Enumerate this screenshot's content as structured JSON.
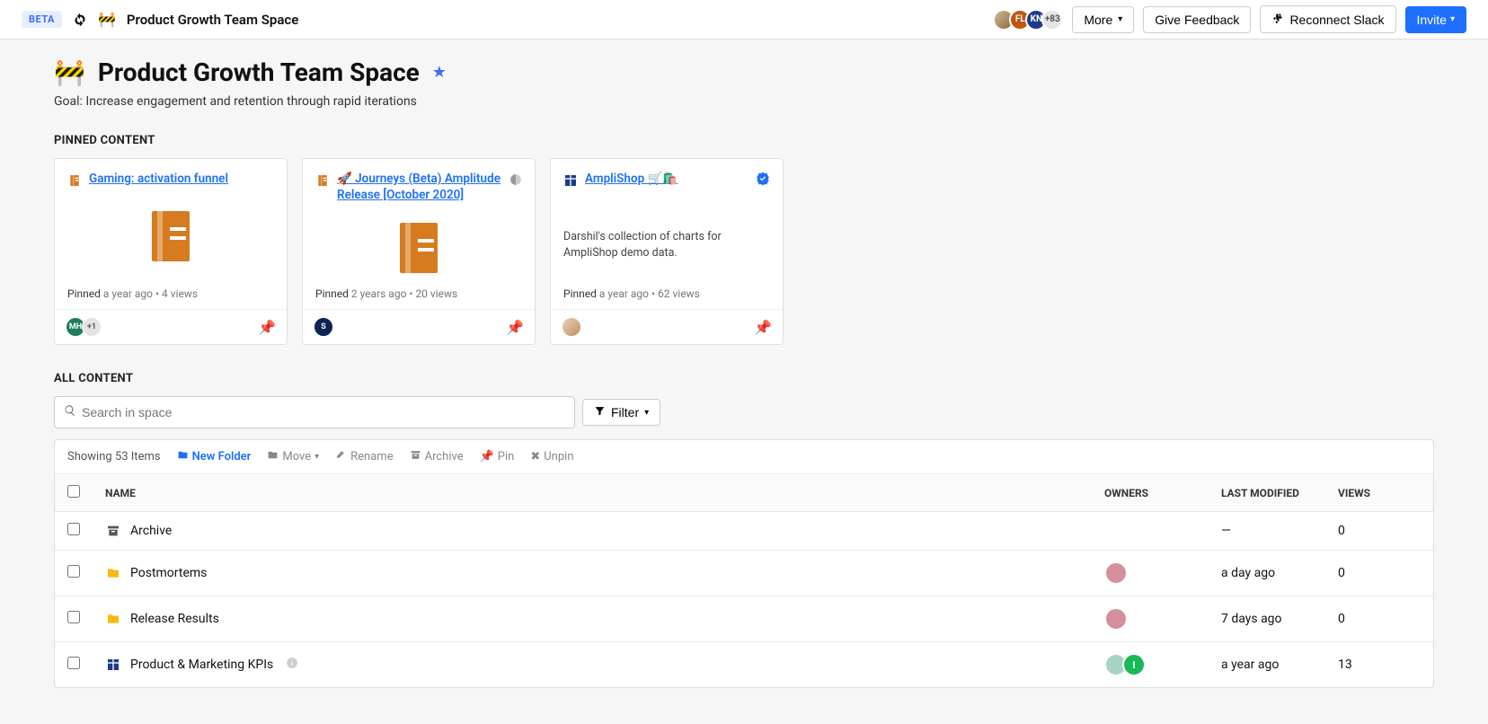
{
  "topbar": {
    "beta": "BETA",
    "emoji": "🚧",
    "crumb": "Product Growth Team Space",
    "avatars": {
      "fl": "FL",
      "kn": "KN",
      "count": "+83"
    },
    "more": "More",
    "feedback": "Give Feedback",
    "reconnect": "Reconnect Slack",
    "invite": "Invite"
  },
  "header": {
    "emoji": "🚧",
    "title": "Product Growth Team Space",
    "goal": "Goal: Increase engagement and retention through rapid iterations"
  },
  "pinned": {
    "label": "PINNED CONTENT",
    "cards": [
      {
        "title": "Gaming: activation funnel",
        "pinned_label": "Pinned",
        "time": "a year ago",
        "views": "4 views",
        "avatar_text": "MH",
        "avatar_extra": "+1"
      },
      {
        "title": "🚀 Journeys (Beta) Amplitude Release [October 2020]",
        "pinned_label": "Pinned",
        "time": "2 years ago",
        "views": "20 views",
        "avatar_text": "S"
      },
      {
        "title": "AmpliShop 🛒🛍️",
        "desc": "Darshil's collection of charts for AmpliShop demo data.",
        "pinned_label": "Pinned",
        "time": "a year ago",
        "views": "62 views"
      }
    ]
  },
  "all": {
    "label": "ALL CONTENT",
    "search_placeholder": "Search in space",
    "filter": "Filter",
    "showing_pre": "Showing",
    "showing_count": "53 Items",
    "actions": {
      "new_folder": "New Folder",
      "move": "Move",
      "rename": "Rename",
      "archive": "Archive",
      "pin": "Pin",
      "unpin": "Unpin"
    },
    "columns": {
      "name": "NAME",
      "owners": "OWNERS",
      "modified": "LAST MODIFIED",
      "views": "VIEWS"
    },
    "rows": [
      {
        "icon": "archive",
        "name": "Archive",
        "owners": [],
        "modified": "—",
        "views": "0"
      },
      {
        "icon": "folder",
        "name": "Postmortems",
        "owners": [
          {
            "type": "img",
            "bg": "#d48f9c"
          }
        ],
        "modified": "a day ago",
        "views": "0"
      },
      {
        "icon": "folder",
        "name": "Release Results",
        "owners": [
          {
            "type": "img",
            "bg": "#d48f9c"
          }
        ],
        "modified": "7 days ago",
        "views": "0"
      },
      {
        "icon": "dash",
        "name": "Product & Marketing KPIs",
        "info": true,
        "owners": [
          {
            "type": "img",
            "bg": "#a7d4c3"
          },
          {
            "type": "letter",
            "bg": "#18b855",
            "text": "I"
          }
        ],
        "modified": "a year ago",
        "views": "13"
      }
    ]
  }
}
